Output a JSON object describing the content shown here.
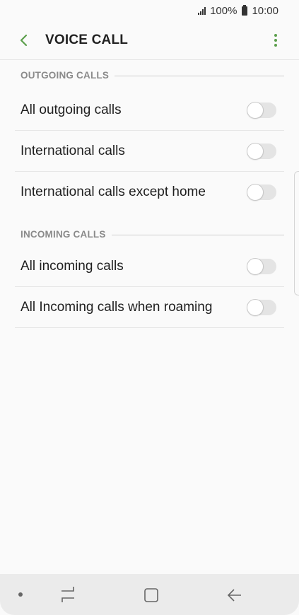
{
  "status": {
    "battery": "100%",
    "time": "10:00"
  },
  "header": {
    "title": "VOICE CALL"
  },
  "sections": [
    {
      "title": "OUTGOING CALLS",
      "items": [
        {
          "label": "All outgoing calls",
          "enabled": false
        },
        {
          "label": "International calls",
          "enabled": false
        },
        {
          "label": "International calls except home",
          "enabled": false
        }
      ]
    },
    {
      "title": "INCOMING CALLS",
      "items": [
        {
          "label": "All incoming calls",
          "enabled": false
        },
        {
          "label": "All Incoming calls when roaming",
          "enabled": false
        }
      ]
    }
  ],
  "colors": {
    "accent": "#5c9f4c",
    "background": "#fafafa",
    "toggle_off": "#e4e4e4"
  },
  "icons": {
    "back": "chevron-left-icon",
    "more": "more-vertical-icon"
  }
}
